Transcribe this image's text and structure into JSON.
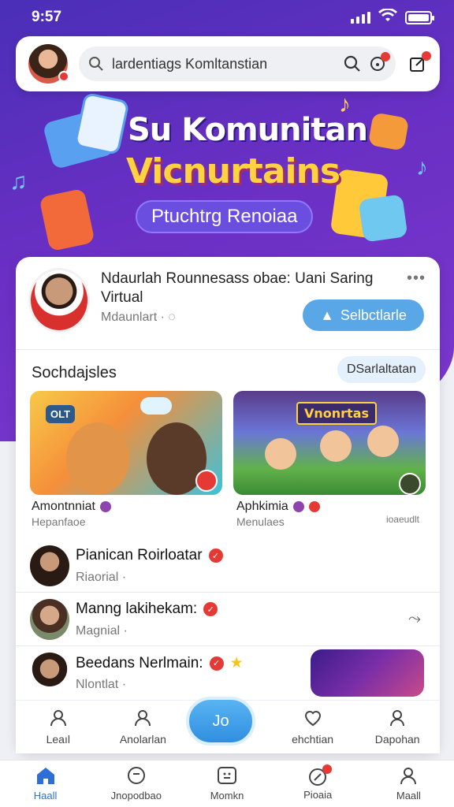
{
  "status_bar": {
    "time": "9:57"
  },
  "search": {
    "value": "",
    "placeholder": "lardentiags Komltanstian"
  },
  "hero": {
    "title_line1": "Su Komunitan",
    "title_line2": "Vicnurtains",
    "pill_label": "Ptuchtrg Renoiaa"
  },
  "post": {
    "title": "Ndaurlah Rounnesass obae: Uani Saring Virtual",
    "meta": "Mdaunlart ·",
    "more_label": "•••",
    "follow_label": "Selbctlarle"
  },
  "section": {
    "title": "Sochdajsles",
    "button_label": "DSarlaltatan",
    "tiles": [
      {
        "name": "Amontnniat",
        "sub": "Hepanfaoe",
        "image_text": "OLT"
      },
      {
        "name": "Aphkimia",
        "sub": "Menulaes",
        "image_text": "Vnonrtas"
      }
    ],
    "count_text": "ioaeudlt"
  },
  "list": [
    {
      "name": "Pianican Roirloatar",
      "sub": "Riaorial ·"
    },
    {
      "name": "Manng lakihekam:",
      "sub": "Magnial ·"
    },
    {
      "name": "Beedans Nerlmain:",
      "sub": "Nlontlat ·"
    }
  ],
  "actions": [
    {
      "label": "Leaıl"
    },
    {
      "label": "Anolarlan"
    },
    {
      "label": "ehchtian"
    },
    {
      "label": "Dapohan"
    }
  ],
  "fab_label": "Jo",
  "tabs": [
    {
      "label": "Haall"
    },
    {
      "label": "Jnopodbao"
    },
    {
      "label": "Momkn"
    },
    {
      "label": "Pioaia"
    },
    {
      "label": "Maall"
    }
  ],
  "colors": {
    "header_gradient_start": "#4a2fb8",
    "header_gradient_end": "#7d39cf",
    "accent_blue": "#5aa7e8",
    "hero_yellow": "#ffd23f",
    "badge_red": "#e53935"
  }
}
